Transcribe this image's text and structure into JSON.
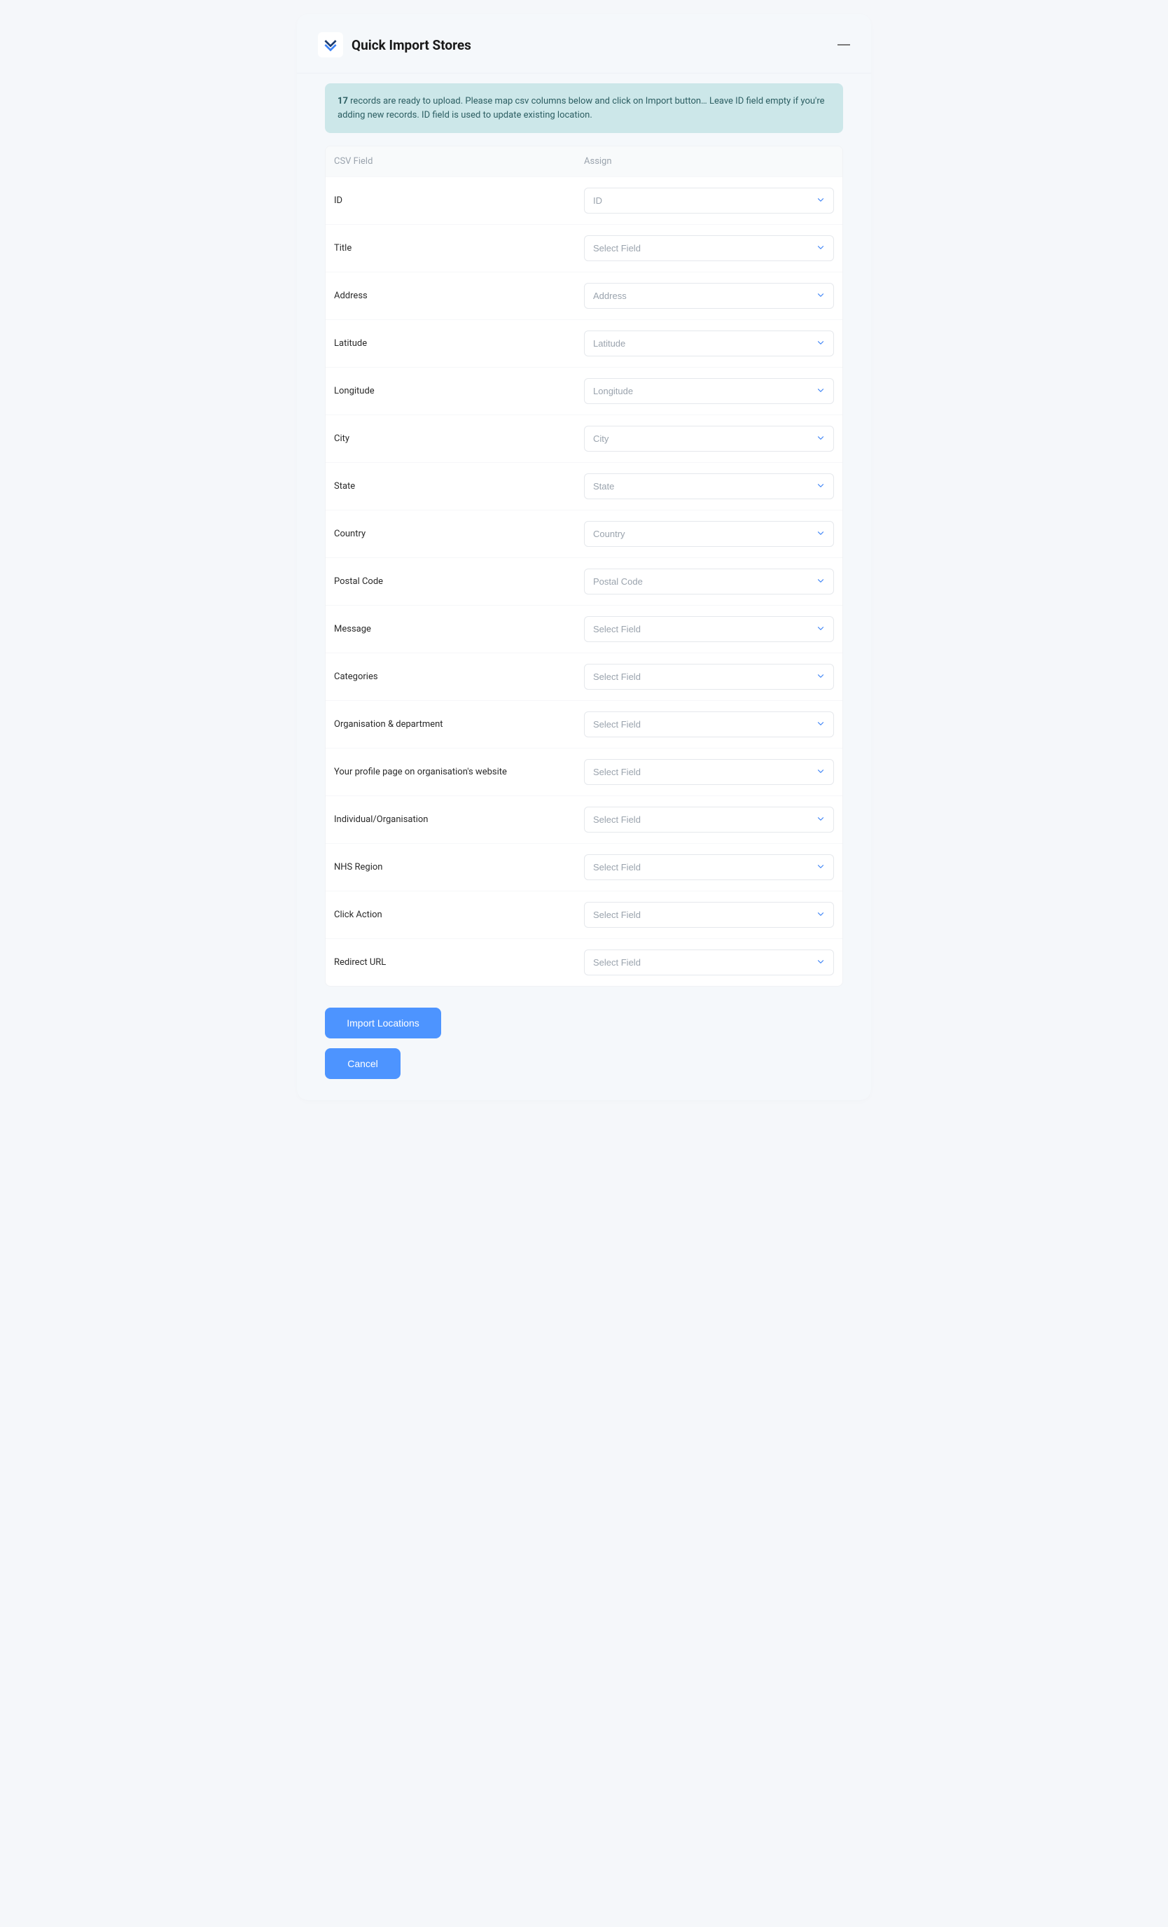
{
  "header": {
    "title": "Quick Import Stores"
  },
  "banner": {
    "count": "17",
    "text_after_count": " records are ready to upload. Please map csv columns below and click on Import button… Leave ID field empty if you're adding new records. ID field is used to update existing location."
  },
  "table": {
    "header_csv": "CSV Field",
    "header_assign": "Assign",
    "rows": [
      {
        "csv": "ID",
        "assigned": "ID"
      },
      {
        "csv": "Title",
        "assigned": "Select Field"
      },
      {
        "csv": "Address",
        "assigned": "Address"
      },
      {
        "csv": "Latitude",
        "assigned": "Latitude"
      },
      {
        "csv": "Longitude",
        "assigned": "Longitude"
      },
      {
        "csv": "City",
        "assigned": "City"
      },
      {
        "csv": "State",
        "assigned": "State"
      },
      {
        "csv": "Country",
        "assigned": "Country"
      },
      {
        "csv": "Postal Code",
        "assigned": "Postal Code"
      },
      {
        "csv": "Message",
        "assigned": "Select Field"
      },
      {
        "csv": "Categories",
        "assigned": "Select Field"
      },
      {
        "csv": "Organisation & department",
        "assigned": "Select Field"
      },
      {
        "csv": "Your profile page on organisation's website",
        "assigned": "Select Field"
      },
      {
        "csv": "Individual/Organisation",
        "assigned": "Select Field"
      },
      {
        "csv": "NHS Region",
        "assigned": "Select Field"
      },
      {
        "csv": "Click Action",
        "assigned": "Select Field"
      },
      {
        "csv": "Redirect URL",
        "assigned": "Select Field"
      }
    ]
  },
  "actions": {
    "import_label": "Import Locations",
    "cancel_label": "Cancel"
  }
}
